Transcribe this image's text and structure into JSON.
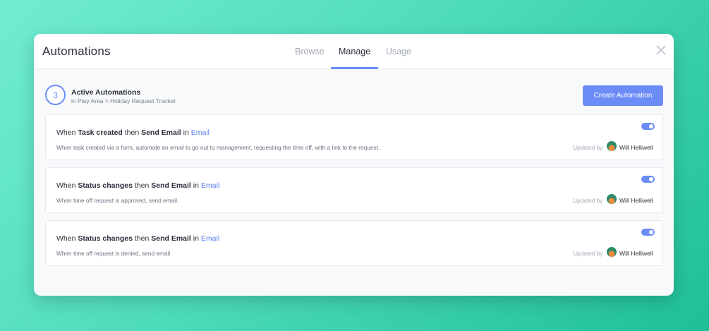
{
  "header": {
    "title": "Automations",
    "tabs": [
      {
        "label": "Browse"
      },
      {
        "label": "Manage"
      },
      {
        "label": "Usage"
      }
    ]
  },
  "section": {
    "count": "3",
    "title": "Active Automations",
    "path": "in Play Area > Holiday Request Tracker",
    "create_label": "Create Automation"
  },
  "accent_color": "#6b8cf6",
  "automations": [
    {
      "when": "When",
      "trigger": "Task created",
      "then": "then",
      "action": "Send Email",
      "in": "in",
      "target": "Email",
      "description": "When task created via a form, automate an email to go out to management, requesting the time off, with a link to the request.",
      "updated_by_label": "Updated by",
      "updated_by": "Will Helliwell",
      "enabled": true
    },
    {
      "when": "When",
      "trigger": "Status changes",
      "then": "then",
      "action": "Send Email",
      "in": "in",
      "target": "Email",
      "description": "When time off request is approved, send email.",
      "updated_by_label": "Updated by",
      "updated_by": "Will Helliwell",
      "enabled": true
    },
    {
      "when": "When",
      "trigger": "Status changes",
      "then": "then",
      "action": "Send Email",
      "in": "in",
      "target": "Email",
      "description": "When time off request is denied, send email.",
      "updated_by_label": "Updated by",
      "updated_by": "Will Helliwell",
      "enabled": true
    }
  ]
}
